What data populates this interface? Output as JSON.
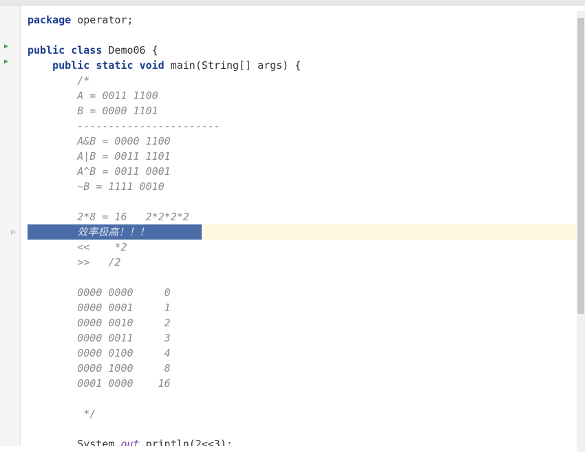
{
  "code": {
    "l1_kw": "package",
    "l1_rest": " operator;",
    "l2_kw1": "public",
    "l2_kw2": "class",
    "l2_rest": " Demo06 {",
    "l3_kw1": "public",
    "l3_kw2": "static",
    "l3_kw3": "void",
    "l3_rest": " main(String[] args) {",
    "l4": "        /*",
    "l5": "        A = 0011 1100",
    "l6": "        B = 0000 1101",
    "l7": "        -----------------------",
    "l8": "        A&B = 0000 1100",
    "l9": "        A|B = 0011 1101",
    "l10": "        A^B = 0011 0001",
    "l11": "        ~B = 1111 0010",
    "l12": "        2*8 = 16   2*2*2*2",
    "l13": "        效率极高！！！",
    "l14": "        <<    *2",
    "l15": "        >>   /2",
    "l16": "        0000 0000     0",
    "l17": "        0000 0001     1",
    "l18": "        0000 0010     2",
    "l19": "        0000 0011     3",
    "l20": "        0000 0100     4",
    "l21": "        0000 1000     8",
    "l22": "        0001 0000    16",
    "l23": "         */",
    "l24_a": "        System.",
    "l24_b": "out",
    "l24_c": ".println(2<<3);"
  },
  "gutter": {
    "run1": "▶",
    "run2": "▶",
    "cursor": "▷"
  },
  "status": {
    "breadcrumb": ""
  }
}
